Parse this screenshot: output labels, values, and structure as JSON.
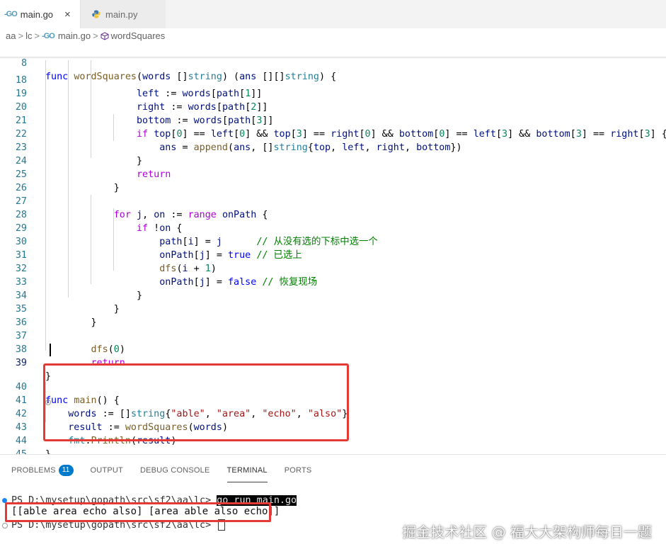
{
  "tabs": [
    {
      "icon": "go-icon",
      "label": "main.go",
      "close": "×"
    },
    {
      "icon": "python-icon",
      "label": "main.py"
    }
  ],
  "breadcrumb": [
    "aa",
    "lc",
    "main.go",
    "wordSquares"
  ],
  "breadcrumb_sep": ">",
  "code_lines": [
    {
      "n": "8"
    },
    {
      "n": "18"
    },
    {
      "n": "19"
    },
    {
      "n": "20"
    },
    {
      "n": "21"
    },
    {
      "n": "22"
    },
    {
      "n": "23"
    },
    {
      "n": "24"
    },
    {
      "n": "25"
    },
    {
      "n": "26"
    },
    {
      "n": "27"
    },
    {
      "n": "28"
    },
    {
      "n": "29"
    },
    {
      "n": "30"
    },
    {
      "n": "31"
    },
    {
      "n": "32"
    },
    {
      "n": "33"
    },
    {
      "n": "34"
    },
    {
      "n": "35"
    },
    {
      "n": "36"
    },
    {
      "n": "37"
    },
    {
      "n": "38"
    },
    {
      "n": "39"
    },
    {
      "n": "40"
    },
    {
      "n": "41"
    },
    {
      "n": "42"
    },
    {
      "n": "43"
    },
    {
      "n": "44"
    },
    {
      "n": "45"
    }
  ],
  "panel_tabs": {
    "problems": "PROBLEMS",
    "problems_count": "11",
    "output": "OUTPUT",
    "debug": "DEBUG CONSOLE",
    "terminal": "TERMINAL",
    "ports": "PORTS"
  },
  "terminal": {
    "prompt1": "PS D:\\mysetup\\gopath\\src\\sf2\\aa\\lc> ",
    "command": "go run main.go",
    "output": "[[able area echo also] [area able also echo]]",
    "prompt2": "PS D:\\mysetup\\gopath\\src\\sf2\\aa\\lc> "
  },
  "watermark": "掘金技术社区 @ 福大大架构师每日一题",
  "colors": {
    "keyword": "#0000ff",
    "control": "#af00db",
    "type": "#267f99",
    "function": "#795e26",
    "string": "#a31515",
    "comment": "#008000",
    "number": "#098658",
    "highlight": "#e53935"
  }
}
